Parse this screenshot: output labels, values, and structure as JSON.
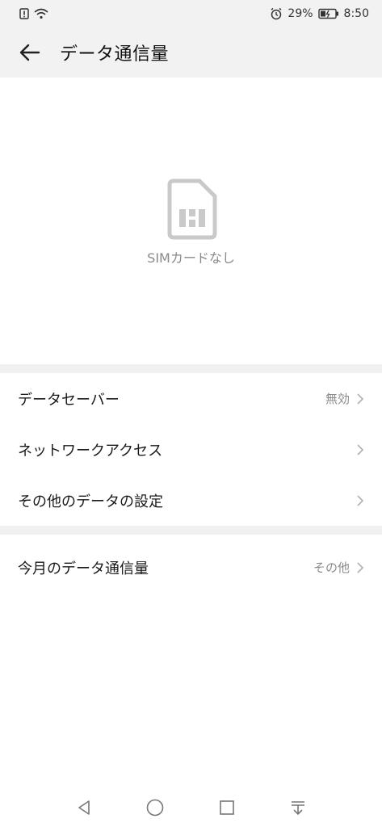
{
  "status_bar": {
    "battery_percent": "29%",
    "time": "8:50",
    "icons": [
      "sim-alert-icon",
      "wifi-icon",
      "alarm-icon",
      "battery-icon"
    ]
  },
  "header": {
    "title": "データ通信量",
    "back_icon": "back-arrow-icon"
  },
  "no_sim": {
    "icon": "sim-card-icon",
    "label": "SIMカードなし"
  },
  "settings": {
    "items": [
      {
        "label": "データセーバー",
        "value": "無効"
      },
      {
        "label": "ネットワークアクセス",
        "value": ""
      },
      {
        "label": "その他のデータの設定",
        "value": ""
      }
    ]
  },
  "usage": {
    "label": "今月のデータ通信量",
    "value": "その他"
  },
  "nav": {
    "icons": [
      "back-triangle-icon",
      "home-circle-icon",
      "recents-square-icon",
      "notification-pull-icon"
    ]
  },
  "colors": {
    "header_bg": "#f2f2f2",
    "divider": "#f0f0f0",
    "secondary_text": "#8a8a8a"
  }
}
